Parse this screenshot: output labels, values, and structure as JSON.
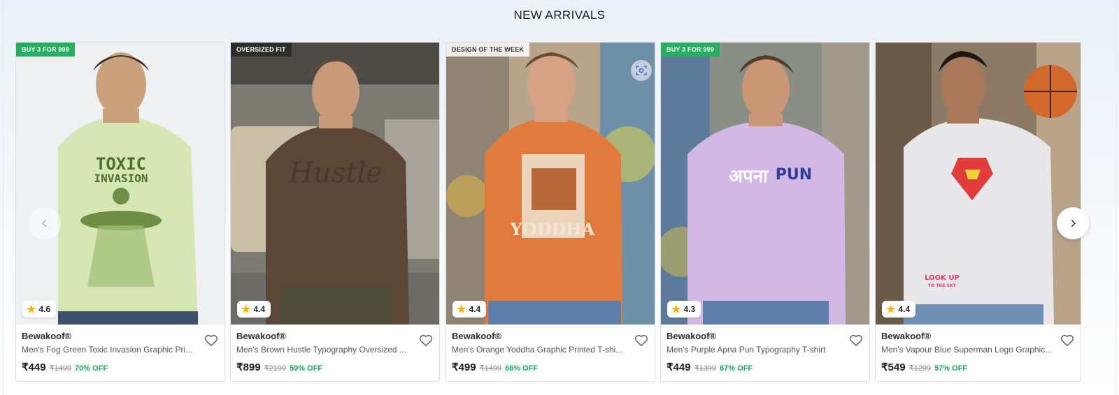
{
  "section": {
    "title": "NEW ARRIVALS"
  },
  "products": [
    {
      "tag": "BUY 3 FOR 999",
      "rating": "4.6",
      "brand": "Bewakoof®",
      "name": "Men's Fog Green Toxic Invasion Graphic Pri...",
      "price": "₹449",
      "mrp": "₹1499",
      "discount": "70% OFF",
      "print_text": [
        "TOXIC",
        "INVASION"
      ]
    },
    {
      "tag": "OVERSIZED FIT",
      "rating": "4.4",
      "brand": "Bewakoof®",
      "name": "Men's Brown Hustle Typography Oversized ...",
      "price": "₹899",
      "mrp": "₹2199",
      "discount": "59% OFF",
      "print_text": [
        "Hustle"
      ]
    },
    {
      "tag": "DESIGN OF THE WEEK",
      "rating": "4.4",
      "brand": "Bewakoof®",
      "name": "Men's Orange Yoddha Graphic Printed T-shi...",
      "price": "₹499",
      "mrp": "₹1499",
      "discount": "66% OFF",
      "print_text": [
        "YODDHA"
      ]
    },
    {
      "tag": "BUY 3 FOR 999",
      "rating": "4.3",
      "brand": "Bewakoof®",
      "name": "Men's Purple Apna Pun Typography T-shirt",
      "price": "₹449",
      "mrp": "₹1399",
      "discount": "67% OFF",
      "print_text": [
        "अपना",
        "PUN"
      ]
    },
    {
      "tag": "",
      "rating": "4.4",
      "brand": "Bewakoof®",
      "name": "Men's Vapour Blue Superman Logo Graphic...",
      "price": "₹549",
      "mrp": "₹1299",
      "discount": "57% OFF",
      "print_text": [
        "LOOK UP",
        "TO THE SKY"
      ]
    }
  ],
  "icons": {
    "rating": "star-icon",
    "wishlist": "heart-outline-icon",
    "prev": "chevron-left-icon",
    "next": "chevron-right-icon",
    "scan": "visual-search-icon"
  },
  "colors": {
    "offer_tag": "#27ae60",
    "discount_text": "#1aa65b",
    "star": "#f5b301"
  }
}
